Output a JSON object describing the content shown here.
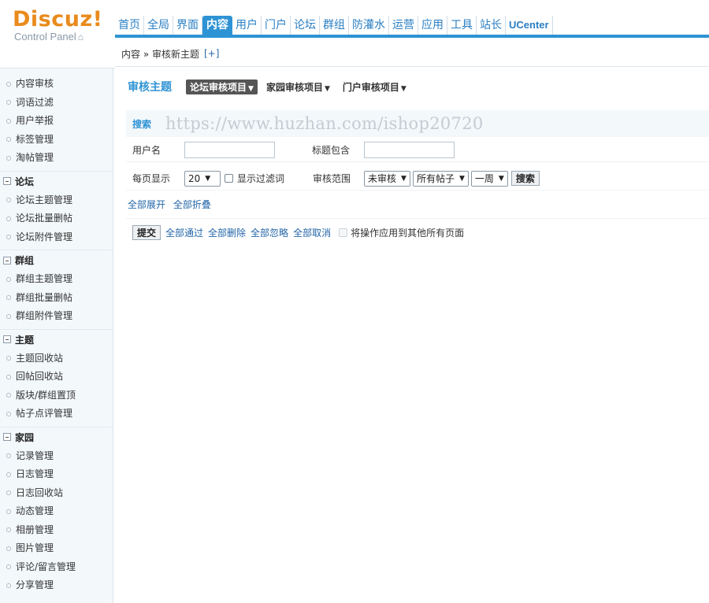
{
  "logo": {
    "title": "Discuz!",
    "subtitle": "Control Panel",
    "home_icon": "home-icon"
  },
  "topnav": {
    "items": [
      "首页",
      "全局",
      "界面",
      "内容",
      "用户",
      "门户",
      "论坛",
      "群组",
      "防灌水",
      "运营",
      "应用",
      "工具",
      "站长",
      "UCenter"
    ],
    "active": "内容"
  },
  "breadcrumb": {
    "text": "内容 » 审核新主题",
    "plus": "[+]"
  },
  "sidebar": {
    "items1": [
      "内容审核",
      "词语过滤",
      "用户举报",
      "标签管理",
      "淘帖管理"
    ],
    "group_forum": "论坛",
    "items_forum": [
      "论坛主题管理",
      "论坛批量删帖",
      "论坛附件管理"
    ],
    "group_group": "群组",
    "items_group": [
      "群组主题管理",
      "群组批量删帖",
      "群组附件管理"
    ],
    "group_topic": "主题",
    "items_topic": [
      "主题回收站",
      "回帖回收站",
      "版块/群组置顶",
      "帖子点评管理"
    ],
    "group_home": "家园",
    "items_home": [
      "记录管理",
      "日志管理",
      "日志回收站",
      "动态管理",
      "相册管理",
      "图片管理",
      "评论/留言管理",
      "分享管理"
    ]
  },
  "main": {
    "title": "审核主题",
    "tabs": [
      "论坛审核项目",
      "家园审核项目",
      "门户审核项目"
    ],
    "search": {
      "label": "搜索",
      "watermark": "https://www.huzhan.com/ishop20720",
      "username_label": "用户名",
      "username_value": "",
      "title_label": "标题包含",
      "title_value": "",
      "perpage_label": "每页显示",
      "perpage_value": "20",
      "show_filtered_label": "显示过滤词",
      "scope_label": "审核范围",
      "scope_status": "未审核",
      "scope_posts": "所有帖子",
      "scope_time": "一周",
      "search_button": "搜索"
    },
    "expand_all": "全部展开",
    "collapse_all": "全部折叠",
    "actions": {
      "submit": "提交",
      "pass_all": "全部通过",
      "delete_all": "全部删除",
      "ignore_all": "全部忽略",
      "cancel_all": "全部取消",
      "apply_all_pages": "将操作应用到其他所有页面"
    }
  }
}
